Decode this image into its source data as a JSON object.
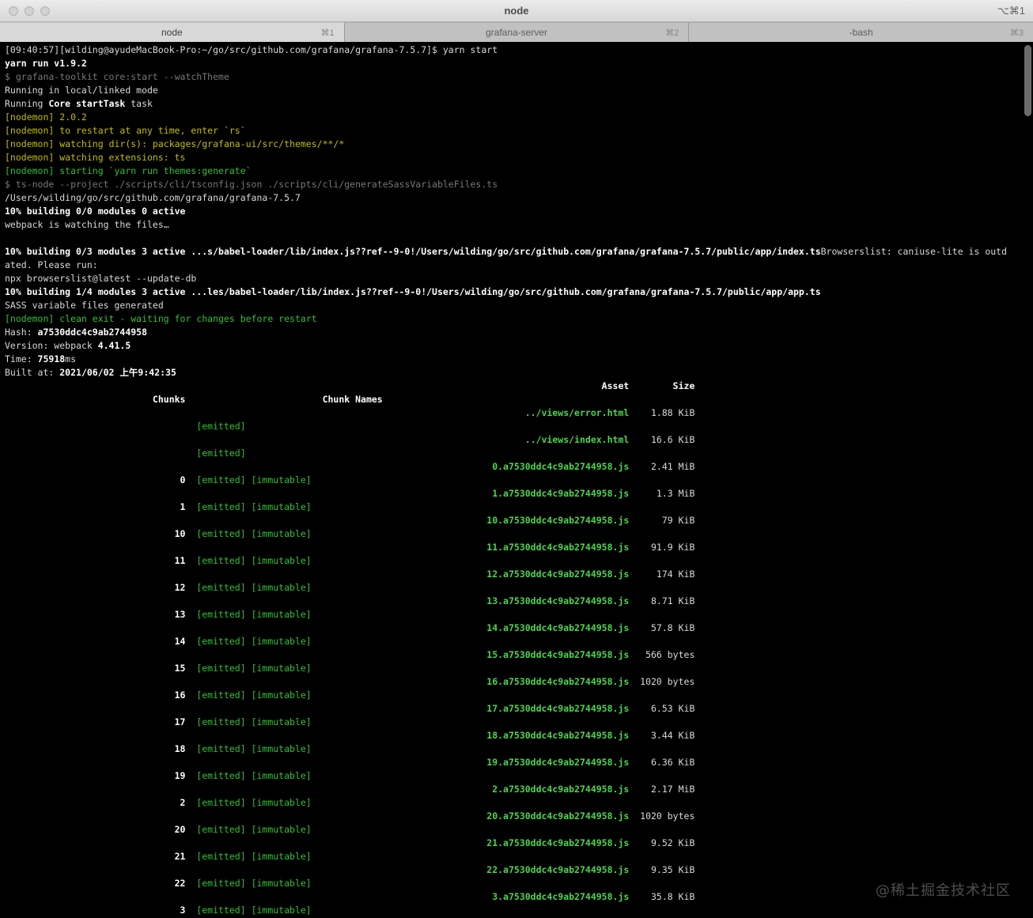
{
  "window": {
    "title": "node",
    "title_shortcut": "⌥⌘1"
  },
  "tabs": [
    {
      "label": "node",
      "shortcut": "⌘1",
      "active": true
    },
    {
      "label": "grafana-server",
      "shortcut": "⌘2",
      "active": false
    },
    {
      "label": "-bash",
      "shortcut": "⌘3",
      "active": false
    }
  ],
  "colors": {
    "w": "#d9d9d9",
    "b": "#ffffff",
    "dim": "#787878",
    "y": "#c2bf00",
    "g": "#33c133",
    "gb": "#4cd64c"
  },
  "terminal": {
    "log_lines": [
      [
        [
          "w",
          "[09:40:57][wilding@ayudeMacBook-Pro:~/go/src/github.com/grafana/grafana-7.5.7]$ yarn start"
        ]
      ],
      [
        [
          "b",
          "yarn run v1.9.2"
        ]
      ],
      [
        [
          "dim",
          "$ grafana-toolkit core:start --watchTheme"
        ]
      ],
      [
        [
          "w",
          "Running in local/linked mode"
        ]
      ],
      [
        [
          "w",
          "Running "
        ],
        [
          "b",
          "Core startTask"
        ],
        [
          "w",
          " task"
        ]
      ],
      [
        [
          "y",
          "[nodemon] 2.0.2"
        ]
      ],
      [
        [
          "y",
          "[nodemon] to restart at any time, enter `rs`"
        ]
      ],
      [
        [
          "y",
          "[nodemon] watching dir(s): packages/grafana-ui/src/themes/**/*"
        ]
      ],
      [
        [
          "y",
          "[nodemon] watching extensions: ts"
        ]
      ],
      [
        [
          "g",
          "[nodemon] starting `yarn run themes:generate`"
        ]
      ],
      [
        [
          "dim",
          "$ ts-node --project ./scripts/cli/tsconfig.json ./scripts/cli/generateSassVariableFiles.ts"
        ]
      ],
      [
        [
          "w",
          "/Users/wilding/go/src/github.com/grafana/grafana-7.5.7"
        ]
      ],
      [
        [
          "b",
          "10% building 0/0 modules 0 active"
        ]
      ],
      [
        [
          "w",
          "webpack is watching the files…"
        ]
      ],
      [],
      [
        [
          "b",
          "10% building 0/3 modules 3 active ...s/babel-loader/lib/index.js??ref--9-0!/Users/wilding/go/src/github.com/grafana/grafana-7.5.7/public/app/index.ts"
        ],
        [
          "w",
          "Browserslist: caniuse-lite is outd"
        ]
      ],
      [
        [
          "w",
          "ated. Please run:"
        ]
      ],
      [
        [
          "w",
          "npx browserslist@latest --update-db"
        ]
      ],
      [
        [
          "b",
          "10% building 1/4 modules 3 active ...les/babel-loader/lib/index.js??ref--9-0!/Users/wilding/go/src/github.com/grafana/grafana-7.5.7/public/app/app.ts"
        ]
      ],
      [
        [
          "w",
          "SASS variable files generated"
        ]
      ],
      [
        [
          "g",
          "[nodemon] clean exit - waiting for changes before restart"
        ]
      ],
      [
        [
          "w",
          "Hash: "
        ],
        [
          "b",
          "a7530ddc4c9ab2744958"
        ]
      ],
      [
        [
          "w",
          "Version: webpack "
        ],
        [
          "b",
          "4.41.5"
        ]
      ],
      [
        [
          "w",
          "Time: "
        ],
        [
          "b",
          "75918"
        ],
        [
          "w",
          "ms"
        ]
      ],
      [
        [
          "w",
          "Built at: "
        ],
        [
          "b",
          "2021/06/02 上午9:42:35"
        ]
      ]
    ],
    "webpack_table": {
      "header": {
        "asset": "Asset",
        "size": "Size",
        "chunks": "Chunks",
        "chunk_names": "Chunk Names"
      },
      "rows": [
        {
          "asset": "../views/error.html",
          "size": "1.88 KiB",
          "chunk": "",
          "flags": "[emitted]"
        },
        {
          "asset": "../views/index.html",
          "size": "16.6 KiB",
          "chunk": "",
          "flags": "[emitted]"
        },
        {
          "asset": "0.a7530ddc4c9ab2744958.js",
          "size": "2.41 MiB",
          "chunk": "0",
          "flags": "[emitted] [immutable]"
        },
        {
          "asset": "1.a7530ddc4c9ab2744958.js",
          "size": "1.3 MiB",
          "chunk": "1",
          "flags": "[emitted] [immutable]"
        },
        {
          "asset": "10.a7530ddc4c9ab2744958.js",
          "size": "79 KiB",
          "chunk": "10",
          "flags": "[emitted] [immutable]"
        },
        {
          "asset": "11.a7530ddc4c9ab2744958.js",
          "size": "91.9 KiB",
          "chunk": "11",
          "flags": "[emitted] [immutable]"
        },
        {
          "asset": "12.a7530ddc4c9ab2744958.js",
          "size": "174 KiB",
          "chunk": "12",
          "flags": "[emitted] [immutable]"
        },
        {
          "asset": "13.a7530ddc4c9ab2744958.js",
          "size": "8.71 KiB",
          "chunk": "13",
          "flags": "[emitted] [immutable]"
        },
        {
          "asset": "14.a7530ddc4c9ab2744958.js",
          "size": "57.8 KiB",
          "chunk": "14",
          "flags": "[emitted] [immutable]"
        },
        {
          "asset": "15.a7530ddc4c9ab2744958.js",
          "size": "566 bytes",
          "chunk": "15",
          "flags": "[emitted] [immutable]"
        },
        {
          "asset": "16.a7530ddc4c9ab2744958.js",
          "size": "1020 bytes",
          "chunk": "16",
          "flags": "[emitted] [immutable]"
        },
        {
          "asset": "17.a7530ddc4c9ab2744958.js",
          "size": "6.53 KiB",
          "chunk": "17",
          "flags": "[emitted] [immutable]"
        },
        {
          "asset": "18.a7530ddc4c9ab2744958.js",
          "size": "3.44 KiB",
          "chunk": "18",
          "flags": "[emitted] [immutable]"
        },
        {
          "asset": "19.a7530ddc4c9ab2744958.js",
          "size": "6.36 KiB",
          "chunk": "19",
          "flags": "[emitted] [immutable]"
        },
        {
          "asset": "2.a7530ddc4c9ab2744958.js",
          "size": "2.17 MiB",
          "chunk": "2",
          "flags": "[emitted] [immutable]"
        },
        {
          "asset": "20.a7530ddc4c9ab2744958.js",
          "size": "1020 bytes",
          "chunk": "20",
          "flags": "[emitted] [immutable]"
        },
        {
          "asset": "21.a7530ddc4c9ab2744958.js",
          "size": "9.52 KiB",
          "chunk": "21",
          "flags": "[emitted] [immutable]"
        },
        {
          "asset": "22.a7530ddc4c9ab2744958.js",
          "size": "9.35 KiB",
          "chunk": "22",
          "flags": "[emitted] [immutable]"
        },
        {
          "asset": "3.a7530ddc4c9ab2744958.js",
          "size": "35.8 KiB",
          "chunk": "3",
          "flags": "[emitted] [immutable]"
        }
      ]
    }
  },
  "watermark": "@稀土掘金技术社区"
}
